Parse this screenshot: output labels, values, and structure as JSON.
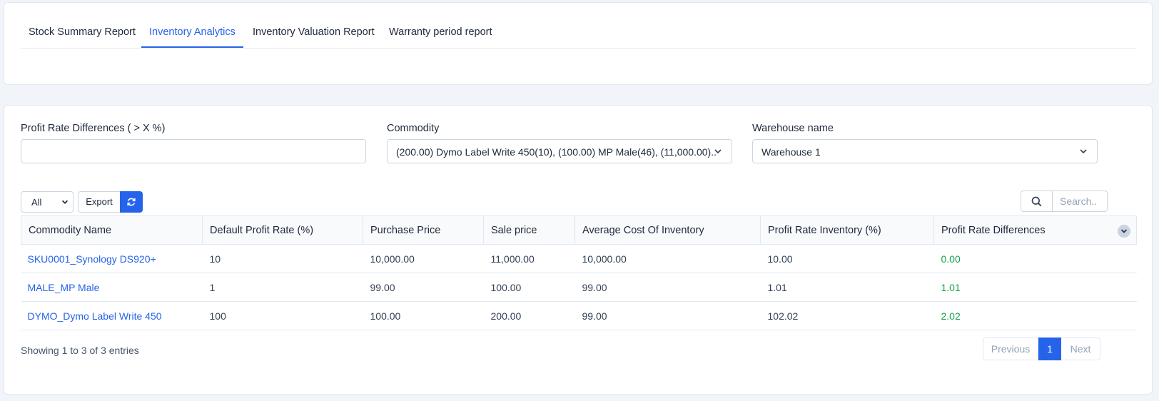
{
  "tabs": [
    {
      "label": "Stock Summary Report"
    },
    {
      "label": "Inventory Analytics"
    },
    {
      "label": "Inventory Valuation Report"
    },
    {
      "label": "Warranty period report"
    }
  ],
  "active_tab": "Inventory Analytics",
  "filters": {
    "profit_rate": {
      "label": "Profit Rate Differences ( > X %)",
      "value": ""
    },
    "commodity": {
      "label": "Commodity",
      "value": "(200.00) Dymo Label Write 450(10), (100.00) MP Male(46), (11,000.00)..."
    },
    "warehouse": {
      "label": "Warehouse name",
      "value": "Warehouse 1"
    }
  },
  "toolbar": {
    "length_value": "All",
    "export_label": "Export",
    "refresh_icon": "refresh-icon",
    "search_icon": "search-icon",
    "search_placeholder": "Search.."
  },
  "table": {
    "columns": [
      "Commodity Name",
      "Default Profit Rate (%)",
      "Purchase Price",
      "Sale price",
      "Average Cost Of Inventory",
      "Profit Rate Inventory (%)",
      "Profit Rate Differences"
    ],
    "rows": [
      [
        "SKU0001_Synology DS920+",
        "10",
        "10,000.00",
        "11,000.00",
        "10,000.00",
        "10.00",
        "0.00"
      ],
      [
        "MALE_MP Male",
        "1",
        "99.00",
        "100.00",
        "99.00",
        "1.01",
        "1.01"
      ],
      [
        "DYMO_Dymo Label Write 450",
        "100",
        "100.00",
        "200.00",
        "99.00",
        "102.02",
        "2.02"
      ]
    ]
  },
  "footer": {
    "info": "Showing 1 to 3 of 3 entries",
    "previous": "Previous",
    "page": "1",
    "next": "Next"
  },
  "colors": {
    "accent": "#2563eb",
    "positive": "#16a34a"
  }
}
